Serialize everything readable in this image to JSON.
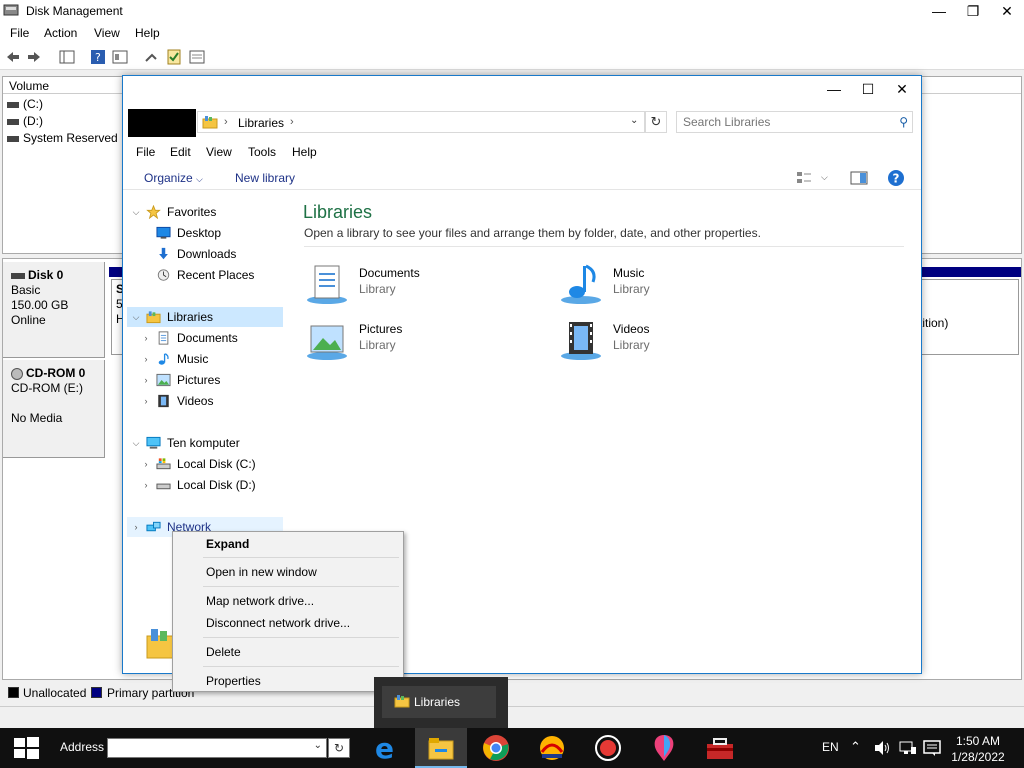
{
  "disk_management": {
    "title": "Disk Management",
    "menu": [
      "File",
      "Action",
      "View",
      "Help"
    ],
    "volume_header": "Volume",
    "volumes": [
      "(C:)",
      "(D:)",
      "System Reserved"
    ],
    "disk0": {
      "name": "Disk 0",
      "type": "Basic",
      "size": "150.00 GB",
      "status": "Online"
    },
    "partition_fragment": {
      "line1": "S",
      "line2": "5(",
      "line3": "H"
    },
    "partition_right_fragment": "tition)",
    "cdrom": {
      "name": "CD-ROM 0",
      "drive": "CD-ROM (E:)",
      "status": "No Media"
    },
    "legend": {
      "unallocated": "Unallocated",
      "primary": "Primary partition"
    }
  },
  "explorer": {
    "breadcrumb": "Libraries",
    "search_placeholder": "Search Libraries",
    "menu": [
      "File",
      "Edit",
      "View",
      "Tools",
      "Help"
    ],
    "commands": {
      "organize": "Organize",
      "new_library": "New library"
    },
    "nav": {
      "favorites": "Favorites",
      "desktop": "Desktop",
      "downloads": "Downloads",
      "recent": "Recent Places",
      "libraries": "Libraries",
      "documents": "Documents",
      "music": "Music",
      "pictures": "Pictures",
      "videos": "Videos",
      "computer": "Ten komputer",
      "local_c": "Local Disk (C:)",
      "local_d": "Local Disk (D:)",
      "network": "Network"
    },
    "content": {
      "title": "Libraries",
      "description": "Open a library to see your files and arrange them by folder, date, and other properties.",
      "tiles": [
        {
          "name": "Documents",
          "type": "Library"
        },
        {
          "name": "Music",
          "type": "Library"
        },
        {
          "name": "Pictures",
          "type": "Library"
        },
        {
          "name": "Videos",
          "type": "Library"
        }
      ]
    }
  },
  "context_menu": {
    "expand": "Expand",
    "open_new_window": "Open in new window",
    "map_drive": "Map network drive...",
    "disconnect_drive": "Disconnect network drive...",
    "delete": "Delete",
    "properties": "Properties"
  },
  "taskbar": {
    "address_label": "Address",
    "preview_label": "Libraries",
    "language": "EN",
    "time": "1:50 AM",
    "date": "1/28/2022"
  },
  "colors": {
    "accent": "#1979ca",
    "library_title": "#1e7145",
    "selection": "#cce8ff",
    "partition": "#000080"
  }
}
